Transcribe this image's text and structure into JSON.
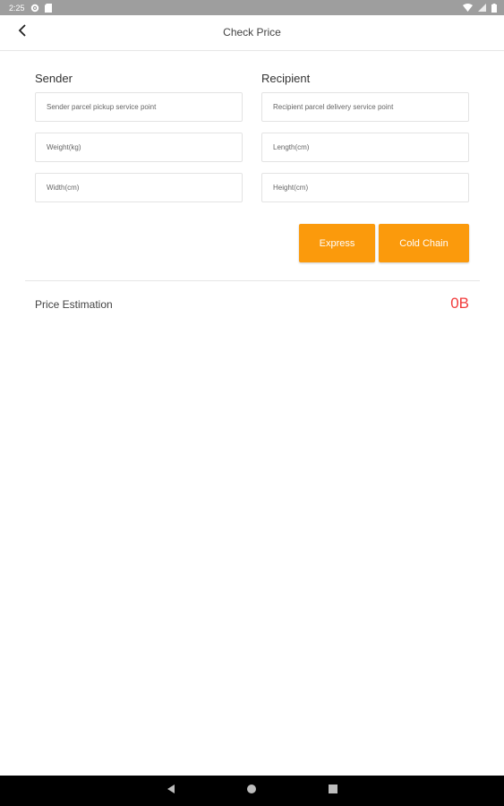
{
  "status_bar": {
    "time": "2:25",
    "icons": [
      "settings-icon",
      "sd-card-icon",
      "wifi-icon",
      "signal-icon",
      "battery-icon"
    ]
  },
  "header": {
    "title": "Check Price",
    "back_icon": "chevron-left-icon"
  },
  "sender": {
    "label": "Sender",
    "pickup_placeholder": "Sender parcel pickup service point",
    "weight_placeholder": "Weight(kg)",
    "width_placeholder": "Width(cm)"
  },
  "recipient": {
    "label": "Recipient",
    "delivery_placeholder": "Recipient parcel delivery service point",
    "length_placeholder": "Length(cm)",
    "height_placeholder": "Height(cm)"
  },
  "buttons": {
    "express": "Express",
    "cold_chain": "Cold Chain"
  },
  "estimate": {
    "label": "Price Estimation",
    "value": "0B"
  },
  "nav_bar": {
    "icons": [
      "back-triangle-icon",
      "home-circle-icon",
      "recents-square-icon"
    ]
  },
  "colors": {
    "accent": "#fb9a0c",
    "price": "#f23b3b",
    "status_bar": "#9e9e9e"
  }
}
